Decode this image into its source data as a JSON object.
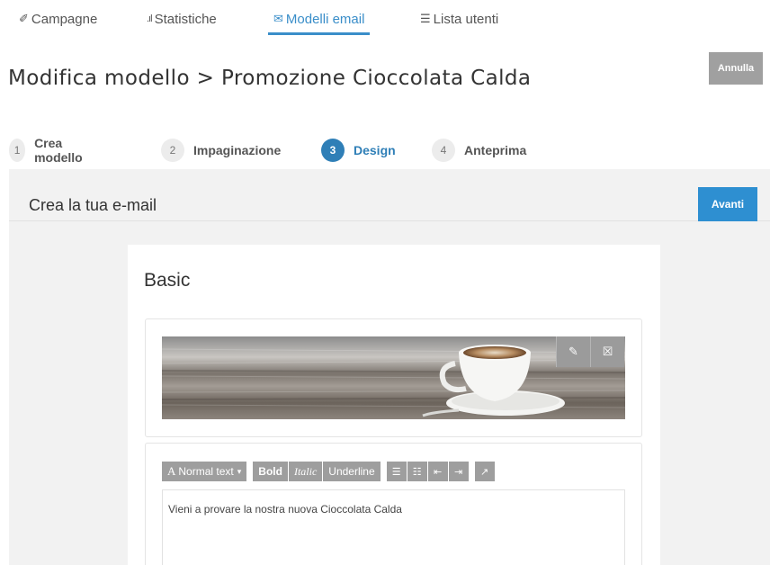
{
  "nav": {
    "tabs": [
      {
        "label": "Campagne",
        "icon": "megaphone-icon",
        "active": false
      },
      {
        "label": "Statistiche",
        "icon": "bar-chart-icon",
        "active": false
      },
      {
        "label": "Modelli email",
        "icon": "envelope-icon",
        "active": true
      },
      {
        "label": "Lista utenti",
        "icon": "list-icon",
        "active": false
      }
    ]
  },
  "header": {
    "title": "Modifica modello > Promozione Cioccolata Calda",
    "cancel_label": "Annulla"
  },
  "steps": [
    {
      "num": "1",
      "label": "Crea modello",
      "active": false
    },
    {
      "num": "2",
      "label": "Impaginazione",
      "active": false
    },
    {
      "num": "3",
      "label": "Design",
      "active": true
    },
    {
      "num": "4",
      "label": "Anteprima",
      "active": false
    }
  ],
  "panel": {
    "title": "Crea la tua e-mail",
    "next_label": "Avanti"
  },
  "template": {
    "name": "Basic",
    "image_tools": [
      "pencil-icon",
      "trash-icon"
    ],
    "toolbar": {
      "format_label": "Normal text",
      "format_icon_letter": "A",
      "bold_label": "Bold",
      "italic_label": "Italic",
      "underline_label": "Underline",
      "icons": [
        "unordered-list-icon",
        "ordered-list-icon",
        "outdent-icon",
        "indent-icon",
        "link-icon"
      ]
    },
    "body_text": "Vieni a provare la nostra nuova Cioccolata Calda"
  },
  "colors": {
    "accent": "#2f7fb7",
    "primary_button": "#2e8fd1",
    "muted_button": "#a0a0a0",
    "panel_bg": "#f2f2f2"
  }
}
